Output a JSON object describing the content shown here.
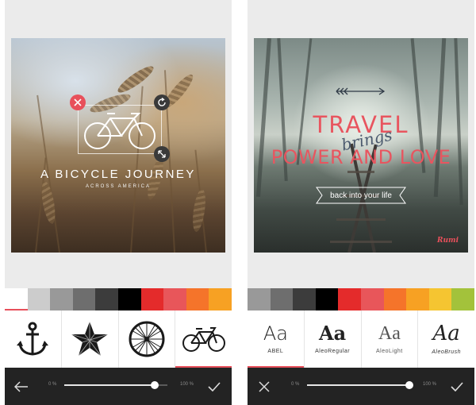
{
  "left_screen": {
    "overlay": {
      "headline": "A BICYCLE JOURNEY",
      "subheadline": "ACROSS AMERICA"
    },
    "swatches": [
      "#ffffff",
      "#cccccc",
      "#999999",
      "#6e6e6e",
      "#3c3c3c",
      "#000000",
      "#e42b2b",
      "#e8565a",
      "#f5742a",
      "#f7a123"
    ],
    "active_swatch": 0,
    "items": [
      {
        "icon": "anchor-icon"
      },
      {
        "icon": "star-icon"
      },
      {
        "icon": "wheel-icon"
      },
      {
        "icon": "bicycle-icon"
      }
    ],
    "active_item": 3,
    "bottom_bar": {
      "back_icon": "back-arrow-icon",
      "confirm_icon": "checkmark-icon",
      "slider_min": "0 %",
      "slider_max": "100 %",
      "slider_value": 0.88
    }
  },
  "right_screen": {
    "overlay": {
      "line1": "TRAVEL",
      "line2": "brings",
      "line3": "POWER AND LOVE",
      "ribbon": "back into your life",
      "signature": "Rumi"
    },
    "swatches": [
      "#999999",
      "#6e6e6e",
      "#3c3c3c",
      "#000000",
      "#e42b2b",
      "#e8565a",
      "#f5742a",
      "#f7a123",
      "#f5c531",
      "#a3c23b"
    ],
    "fonts": [
      {
        "sample": "Aa",
        "name": "ABEL"
      },
      {
        "sample": "Aa",
        "name": "AleoRegular"
      },
      {
        "sample": "Aa",
        "name": "AleoLight"
      },
      {
        "sample": "Aa",
        "name": "AleoBrush"
      }
    ],
    "active_font": 0,
    "bottom_bar": {
      "close_icon": "close-icon",
      "confirm_icon": "checkmark-icon",
      "slider_min": "0 %",
      "slider_max": "100 %",
      "slider_value": 0.99
    }
  },
  "colors": {
    "accent": "#e8505b",
    "bar_bg": "#232323",
    "panel_bg": "#ebebeb"
  }
}
